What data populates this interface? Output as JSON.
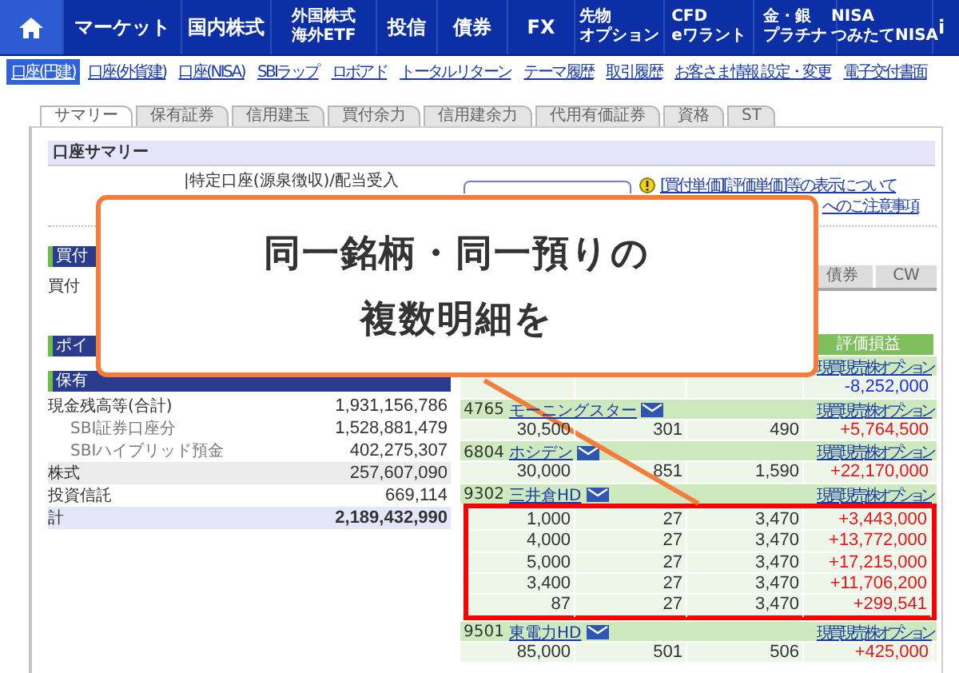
{
  "nav": [
    {
      "kind": "home",
      "selected": true
    },
    {
      "kind": "text",
      "label": "マーケット",
      "selected": false
    },
    {
      "kind": "text",
      "label": "国内株式",
      "selected": false
    },
    {
      "kind": "text",
      "label": "外国株式",
      "sub": "海外ETF",
      "selected": false
    },
    {
      "kind": "text",
      "label": "投信",
      "selected": false
    },
    {
      "kind": "text",
      "label": "債券",
      "selected": false
    },
    {
      "kind": "text",
      "label": "FX",
      "selected": false
    },
    {
      "kind": "text",
      "label": "先物",
      "sub": "オプション",
      "selected": false
    },
    {
      "kind": "text",
      "label": "CFD",
      "sub": "eワラント",
      "selected": false
    },
    {
      "kind": "text",
      "label": "金・銀",
      "sub": "プラチナ",
      "selected": false
    },
    {
      "kind": "text",
      "label": "NISA",
      "sub": "つみたてNISA",
      "selected": false
    },
    {
      "kind": "text",
      "label": "i",
      "selected": false
    }
  ],
  "subnav": [
    {
      "label": "口座(円建)",
      "selected": true
    },
    {
      "label": "口座(外貨建)",
      "selected": false
    },
    {
      "label": "口座(NISA)",
      "selected": false
    },
    {
      "label": "SBIラップ",
      "selected": false
    },
    {
      "label": "ロボアド",
      "selected": false
    },
    {
      "label": "トータルリターン",
      "selected": false
    },
    {
      "label": "テーマ履歴",
      "selected": false
    },
    {
      "label": "取引履歴",
      "selected": false
    },
    {
      "label": "お客さま情報 設定・変更",
      "selected": false
    },
    {
      "label": "電子交付書面",
      "selected": false
    }
  ],
  "tabs": [
    {
      "label": "サマリー",
      "selected": true
    },
    {
      "label": "保有証券",
      "selected": false
    },
    {
      "label": "信用建玉",
      "selected": false
    },
    {
      "label": "買付余力",
      "selected": false
    },
    {
      "label": "信用建余力",
      "selected": false
    },
    {
      "label": "代用有価証券",
      "selected": false
    },
    {
      "label": "資格",
      "selected": false
    },
    {
      "label": "ST",
      "selected": false
    }
  ],
  "summary": {
    "title": "口座サマリー",
    "account_type": "|特定口座(源泉徴収)/配当受入",
    "notice_links": [
      "[買付単価][評価単価]等の表示について",
      "へのご注意事項"
    ]
  },
  "left": {
    "headers": [
      "買付",
      "ポイ",
      "保有"
    ],
    "buying_label": "買付",
    "balances": [
      {
        "kind": "main",
        "label": "現金残高等(合計)",
        "value": "1,931,156,786"
      },
      {
        "kind": "sub",
        "label": "SBI証券口座分",
        "value": "1,528,881,479"
      },
      {
        "kind": "sub",
        "label": "SBIハイブリッド預金",
        "value": "402,275,307"
      },
      {
        "kind": "shaded",
        "label": "株式",
        "value": "257,607,090"
      },
      {
        "kind": "main",
        "label": "投資信託",
        "value": "669,114"
      },
      {
        "kind": "total",
        "label": "計",
        "value": "2,189,432,990"
      }
    ]
  },
  "right": {
    "asset_tabs": [
      "債券",
      "CW"
    ],
    "header": "評価損益",
    "groups": [
      {
        "actions": [
          "現買",
          "現売",
          "株オプション"
        ],
        "highlighted": false,
        "rows": [
          {
            "pl": "-8,252,000",
            "color": "#2030e0"
          }
        ]
      },
      {
        "code": "4765",
        "name": "モーニングスター",
        "actions": [
          "現買",
          "現売",
          "株オプション"
        ],
        "highlighted": false,
        "rows": [
          {
            "values": [
              "30,500",
              "301",
              "490"
            ],
            "pl": "+5,764,500",
            "color": "#e8141e"
          }
        ]
      },
      {
        "code": "6804",
        "name": "ホシデン",
        "actions": [
          "現買",
          "現売",
          "株オプション"
        ],
        "highlighted": false,
        "rows": [
          {
            "values": [
              "30,000",
              "851",
              "1,590"
            ],
            "pl": "+22,170,000",
            "color": "#e8141e"
          }
        ]
      },
      {
        "code": "9302",
        "name": "三井倉HD",
        "actions": [
          "現買",
          "現売",
          "株オプション"
        ],
        "highlighted": true,
        "rows": [
          {
            "values": [
              "1,000",
              "27",
              "3,470"
            ],
            "pl": "+3,443,000",
            "color": "#e8141e"
          },
          {
            "values": [
              "4,000",
              "27",
              "3,470"
            ],
            "pl": "+13,772,000",
            "color": "#e8141e"
          },
          {
            "values": [
              "5,000",
              "27",
              "3,470"
            ],
            "pl": "+17,215,000",
            "color": "#e8141e"
          },
          {
            "values": [
              "3,400",
              "27",
              "3,470"
            ],
            "pl": "+11,706,200",
            "color": "#e8141e"
          },
          {
            "values": [
              "87",
              "27",
              "3,470"
            ],
            "pl": "+299,541",
            "color": "#e8141e"
          }
        ]
      },
      {
        "code": "9501",
        "name": "東電力HD",
        "actions": [
          "現買",
          "現売",
          "株オプション"
        ],
        "highlighted": false,
        "rows": [
          {
            "values": [
              "85,000",
              "501",
              "506"
            ],
            "pl": "+425,000",
            "color": "#e8141e"
          }
        ]
      }
    ]
  },
  "callout": {
    "lines": [
      "同一銘柄・同一預りの",
      "複数明細を"
    ]
  }
}
